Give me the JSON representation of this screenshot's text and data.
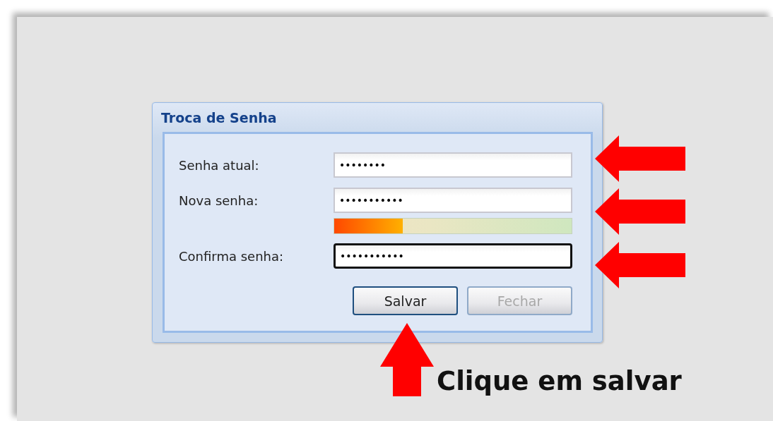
{
  "dialog": {
    "title": "Troca de Senha"
  },
  "fields": [
    {
      "label": "Senha atual:",
      "value": "••••••••",
      "focused": false
    },
    {
      "label": "Nova senha:",
      "value": "•••••••••••",
      "focused": false
    },
    {
      "label": "Confirma senha:",
      "value": "•••••••••••",
      "focused": true
    }
  ],
  "strength_meter": {
    "level": 0.29
  },
  "buttons": [
    {
      "label": "Salvar",
      "disabled": false
    },
    {
      "label": "Fechar",
      "disabled": true
    }
  ],
  "annotation": {
    "caption": "Clique em salvar"
  }
}
